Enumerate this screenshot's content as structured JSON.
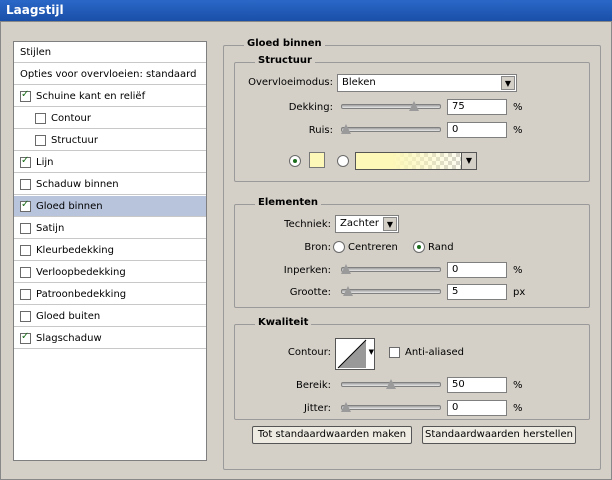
{
  "window": {
    "title": "Laagstijl"
  },
  "styles_panel": {
    "items": [
      {
        "label": "Stijlen",
        "checkbox": false,
        "checked": false,
        "selected": false,
        "sub": false
      },
      {
        "label": "Opties voor overvloeien: standaard",
        "checkbox": false,
        "checked": false,
        "selected": false,
        "sub": false
      },
      {
        "label": "Schuine kant en reliëf",
        "checkbox": true,
        "checked": true,
        "selected": false,
        "sub": false
      },
      {
        "label": "Contour",
        "checkbox": true,
        "checked": false,
        "selected": false,
        "sub": true
      },
      {
        "label": "Structuur",
        "checkbox": true,
        "checked": false,
        "selected": false,
        "sub": true
      },
      {
        "label": "Lijn",
        "checkbox": true,
        "checked": true,
        "selected": false,
        "sub": false
      },
      {
        "label": "Schaduw binnen",
        "checkbox": true,
        "checked": false,
        "selected": false,
        "sub": false
      },
      {
        "label": "Gloed binnen",
        "checkbox": true,
        "checked": true,
        "selected": true,
        "sub": false
      },
      {
        "label": "Satijn",
        "checkbox": true,
        "checked": false,
        "selected": false,
        "sub": false
      },
      {
        "label": "Kleurbedekking",
        "checkbox": true,
        "checked": false,
        "selected": false,
        "sub": false
      },
      {
        "label": "Verloopbedekking",
        "checkbox": true,
        "checked": false,
        "selected": false,
        "sub": false
      },
      {
        "label": "Patroonbedekking",
        "checkbox": true,
        "checked": false,
        "selected": false,
        "sub": false
      },
      {
        "label": "Gloed buiten",
        "checkbox": true,
        "checked": false,
        "selected": false,
        "sub": false
      },
      {
        "label": "Slagschaduw",
        "checkbox": true,
        "checked": true,
        "selected": false,
        "sub": false
      }
    ]
  },
  "inner_glow": {
    "title": "Gloed binnen",
    "structure": {
      "title": "Structuur",
      "blend_mode_label": "Overvloeimodus:",
      "blend_mode_value": "Bleken",
      "opacity_label": "Dekking:",
      "opacity_value": "75",
      "opacity_level": 0.75,
      "noise_label": "Ruis:",
      "noise_value": "0",
      "noise_level": 0,
      "percent": "%",
      "color_swatch": "#fdf8b8"
    },
    "elements": {
      "title": "Elementen",
      "technique_label": "Techniek:",
      "technique_value": "Zachter",
      "source_label": "Bron:",
      "source_center": "Centreren",
      "source_edge": "Rand",
      "choke_label": "Inperken:",
      "choke_value": "0",
      "choke_level": 0,
      "size_label": "Grootte:",
      "size_value": "5",
      "size_level": 0.02,
      "percent": "%",
      "px": "px"
    },
    "quality": {
      "title": "Kwaliteit",
      "contour_label": "Contour:",
      "antialias_label": "Anti-aliased",
      "range_label": "Bereik:",
      "range_value": "50",
      "range_level": 0.5,
      "jitter_label": "Jitter:",
      "jitter_value": "0",
      "jitter_level": 0,
      "percent": "%"
    },
    "buttons": {
      "make_default": "Tot standaardwaarden maken",
      "reset_default": "Standaardwaarden herstellen"
    }
  }
}
